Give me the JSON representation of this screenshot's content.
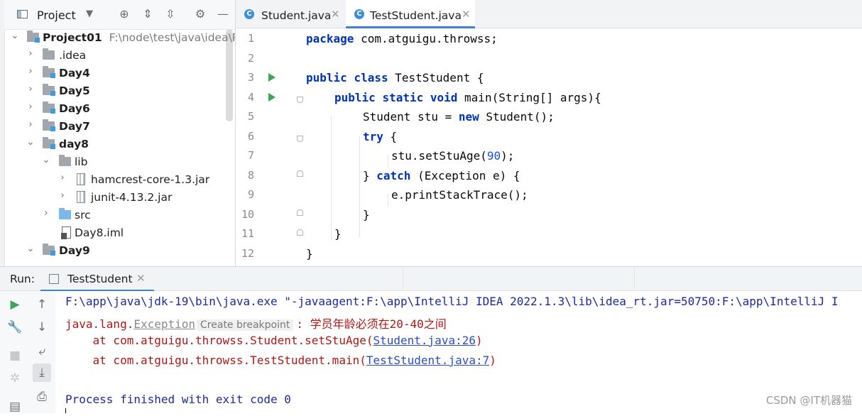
{
  "project_panel": {
    "title": "Project",
    "tree": [
      {
        "label": "Project01",
        "path": "F:\\node\\test\\java\\idea\\Pro",
        "type": "module",
        "expanded": true
      },
      {
        "label": ".idea",
        "type": "folder",
        "expanded": false
      },
      {
        "label": "Day4",
        "type": "module",
        "expanded": false
      },
      {
        "label": "Day5",
        "type": "module",
        "expanded": false
      },
      {
        "label": "Day6",
        "type": "module",
        "expanded": false
      },
      {
        "label": "Day7",
        "type": "module",
        "expanded": false
      },
      {
        "label": "day8",
        "type": "module",
        "expanded": true
      },
      {
        "label": "lib",
        "type": "folder",
        "expanded": true
      },
      {
        "label": "hamcrest-core-1.3.jar",
        "type": "jar",
        "expanded": false
      },
      {
        "label": "junit-4.13.2.jar",
        "type": "jar",
        "expanded": false
      },
      {
        "label": "src",
        "type": "source-folder",
        "expanded": false
      },
      {
        "label": "Day8.iml",
        "type": "iml"
      },
      {
        "label": "Day9",
        "type": "module",
        "expanded": true
      }
    ]
  },
  "editor": {
    "tabs": [
      {
        "label": "Student.java",
        "active": false
      },
      {
        "label": "TestStudent.java",
        "active": true
      }
    ],
    "line_numbers": [
      "1",
      "2",
      "3",
      "4",
      "5",
      "6",
      "7",
      "8",
      "9",
      "10",
      "11",
      "12"
    ],
    "code": {
      "l1_kw": "package",
      "l1_rest": " com.atguigu.throwss;",
      "l3_kw1": "public",
      "l3_kw2": "class",
      "l3_rest": " TestStudent {",
      "l4_kw1": "public",
      "l4_kw2": "static",
      "l4_kw3": "void",
      "l4_rest": " main(String[] args){",
      "l5_a": "Student stu = ",
      "l5_kw": "new",
      "l5_b": " Student();",
      "l6_kw": "try",
      "l6_rest": " {",
      "l7_a": "stu.setStuAge(",
      "l7_num": "90",
      "l7_b": ");",
      "l8_a": "} ",
      "l8_kw": "catch",
      "l8_b": " (Exception e) {",
      "l9": "e.printStackTrace();",
      "l10": "}",
      "l11": "}",
      "l12": "}"
    }
  },
  "run_panel": {
    "title": "Run:",
    "tab_label": "TestStudent",
    "console": {
      "cmd": "F:\\app\\java\\jdk-19\\bin\\java.exe \"-javaagent:F:\\app\\IntelliJ IDEA 2022.1.3\\lib\\idea_rt.jar=50750:F:\\app\\IntelliJ I",
      "exc_prefix": "java.lang.",
      "exc_name": "Exception",
      "create_bp": "Create breakpoint",
      "exc_msg": ": 学员年龄必须在20-40之间",
      "trace1_prefix": "    at com.atguigu.throwss.Student.setStuAge(",
      "trace1_link": "Student.java:26",
      "trace1_suffix": ")",
      "trace2_prefix": "    at com.atguigu.throwss.TestStudent.main(",
      "trace2_link": "TestStudent.java:7",
      "trace2_suffix": ")",
      "finish": "Process finished with exit code 0"
    }
  },
  "watermark": "CSDN @IT机器猫",
  "colors": {
    "keyword": "#0033b3",
    "number": "#1750eb",
    "error_text": "#b11616",
    "console_blue": "#1c2b99",
    "link": "#2a4ec6",
    "run_green": "#3fa55b",
    "tab_underline": "#4083c9"
  }
}
